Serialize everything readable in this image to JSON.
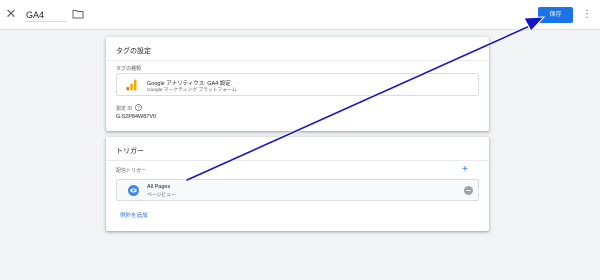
{
  "topbar": {
    "tag_name": "GA4",
    "save_label": "保存",
    "close_icon": "close-icon",
    "folder_icon": "folder-icon",
    "more_icon": "more-vert-icon"
  },
  "tag_config": {
    "title": "タグの設定",
    "type_label": "タグの種類",
    "type_name": "Google アナリティクス: GA4 設定",
    "type_sub": "Google マーケティング プラットフォーム",
    "measurement_label": "測定 ID",
    "measurement_value": "G-52P84W87V0"
  },
  "triggering": {
    "title": "トリガー",
    "firing_label": "配信トリガー",
    "trigger_name": "All Pages",
    "trigger_type": "ページビュー",
    "add_exception": "例外を追加"
  },
  "colors": {
    "accent": "#1a73e8",
    "arrow": "#1515c8",
    "analytics_orange": "#f9ab00",
    "analytics_dark_orange": "#e37400"
  }
}
